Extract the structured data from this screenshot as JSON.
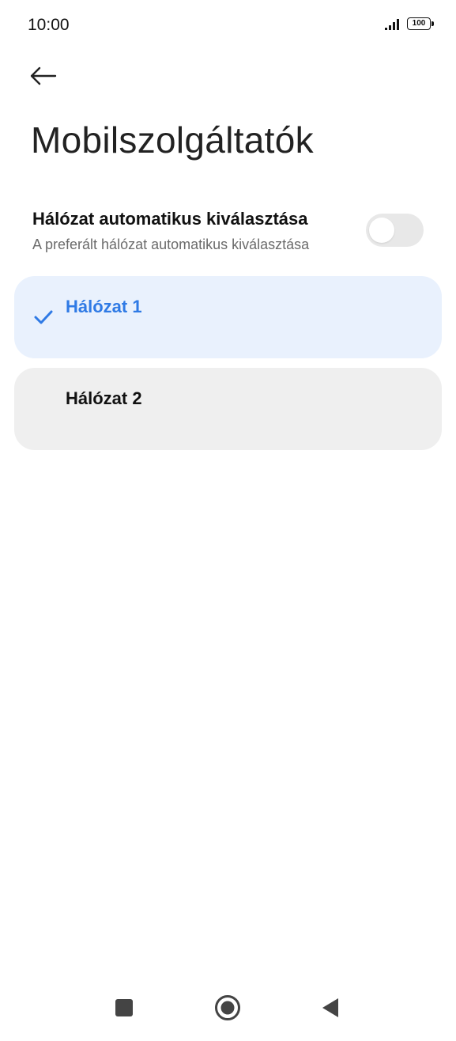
{
  "status_bar": {
    "time": "10:00",
    "battery": "100",
    "icons": [
      "signal-icon",
      "battery-icon"
    ]
  },
  "header": {
    "back_icon": "back-arrow-icon",
    "title": "Mobilszolgáltatók"
  },
  "auto_select": {
    "title": "Hálózat automatikus kiválasztása",
    "subtitle": "A preferált hálózat automatikus kiválasztása",
    "enabled": false
  },
  "networks": [
    {
      "label": "Hálózat 1",
      "selected": true
    },
    {
      "label": "Hálózat 2",
      "selected": false
    }
  ],
  "nav_bar": {
    "icons": [
      "recents-icon",
      "home-icon",
      "back-icon"
    ]
  },
  "colors": {
    "accent": "#2f7ae5",
    "selected_bg": "#e9f1fd",
    "card_bg": "#efefef",
    "toggle_off": "#e8e8e8"
  }
}
